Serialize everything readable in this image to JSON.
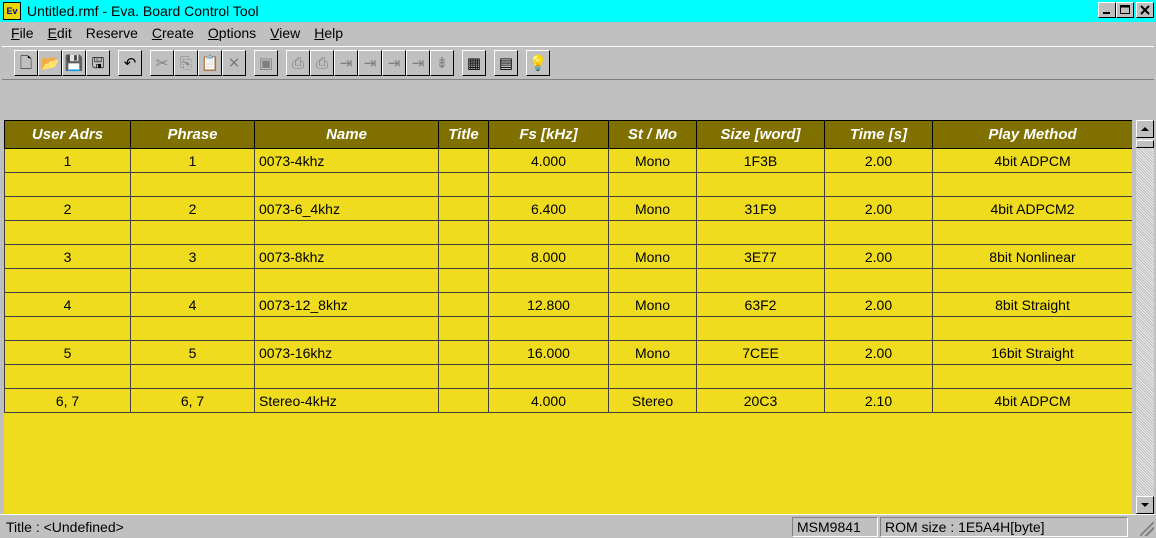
{
  "window": {
    "icon_text": "Ev",
    "title": "Untitled.rmf - Eva. Board Control Tool"
  },
  "menu": [
    {
      "label": "File",
      "underline": "F"
    },
    {
      "label": "Edit",
      "underline": "E"
    },
    {
      "label": "Reserve",
      "underline": ""
    },
    {
      "label": "Create",
      "underline": "C"
    },
    {
      "label": "Options",
      "underline": "O"
    },
    {
      "label": "View",
      "underline": "V"
    },
    {
      "label": "Help",
      "underline": "H"
    }
  ],
  "toolbar": {
    "buttons": [
      {
        "name": "new-document-icon",
        "glyph": "🗋",
        "enabled": true
      },
      {
        "name": "open-folder-icon",
        "glyph": "📂",
        "enabled": true
      },
      {
        "name": "save-icon",
        "glyph": "💾",
        "enabled": true
      },
      {
        "name": "save-as-icon",
        "glyph": "🖫",
        "enabled": true
      },
      {
        "name": "undo-icon",
        "glyph": "↶",
        "enabled": true
      },
      {
        "name": "cut-icon",
        "glyph": "✂",
        "enabled": false
      },
      {
        "name": "copy-icon",
        "glyph": "⎘",
        "enabled": false
      },
      {
        "name": "paste-icon",
        "glyph": "📋",
        "enabled": false
      },
      {
        "name": "delete-icon",
        "glyph": "✕",
        "enabled": false
      },
      {
        "name": "select-all-icon",
        "glyph": "▣",
        "enabled": false
      },
      {
        "name": "print-icon",
        "glyph": "⎙",
        "enabled": false
      },
      {
        "name": "print-setup-icon",
        "glyph": "⎙",
        "enabled": false
      },
      {
        "name": "insert-s-icon",
        "glyph": "⇥",
        "enabled": false
      },
      {
        "name": "insert-c-icon",
        "glyph": "⇥",
        "enabled": false
      },
      {
        "name": "insert-p-icon",
        "glyph": "⇥",
        "enabled": false
      },
      {
        "name": "insert-b-icon",
        "glyph": "⇥",
        "enabled": false
      },
      {
        "name": "insert-row-icon",
        "glyph": "⇟",
        "enabled": false
      },
      {
        "name": "chip-icon",
        "glyph": "▦",
        "enabled": true
      },
      {
        "name": "board-window-icon",
        "glyph": "▤",
        "enabled": true
      },
      {
        "name": "help-bulb-icon",
        "glyph": "💡",
        "enabled": true
      }
    ]
  },
  "table": {
    "columns": [
      "User Adrs",
      "Phrase",
      "Name",
      "Title",
      "Fs [kHz]",
      "St / Mo",
      "Size [word]",
      "Time [s]",
      "Play Method"
    ],
    "rows": [
      [
        "1",
        "1",
        "0073-4khz",
        "",
        "4.000",
        "Mono",
        "1F3B",
        "2.00",
        "4bit ADPCM"
      ],
      [
        "",
        "",
        "",
        "",
        "",
        "",
        "",
        "",
        ""
      ],
      [
        "2",
        "2",
        "0073-6_4khz",
        "",
        "6.400",
        "Mono",
        "31F9",
        "2.00",
        "4bit ADPCM2"
      ],
      [
        "",
        "",
        "",
        "",
        "",
        "",
        "",
        "",
        ""
      ],
      [
        "3",
        "3",
        "0073-8khz",
        "",
        "8.000",
        "Mono",
        "3E77",
        "2.00",
        "8bit Nonlinear"
      ],
      [
        "",
        "",
        "",
        "",
        "",
        "",
        "",
        "",
        ""
      ],
      [
        "4",
        "4",
        "0073-12_8khz",
        "",
        "12.800",
        "Mono",
        "63F2",
        "2.00",
        "8bit Straight"
      ],
      [
        "",
        "",
        "",
        "",
        "",
        "",
        "",
        "",
        ""
      ],
      [
        "5",
        "5",
        "0073-16khz",
        "",
        "16.000",
        "Mono",
        "7CEE",
        "2.00",
        "16bit Straight"
      ],
      [
        "",
        "",
        "",
        "",
        "",
        "",
        "",
        "",
        ""
      ],
      [
        "6, 7",
        "6, 7",
        "Stereo-4kHz",
        "",
        "4.000",
        "Stereo",
        "20C3",
        "2.10",
        "4bit ADPCM"
      ]
    ]
  },
  "status": {
    "title_text": "Title : <Undefined>",
    "device": "MSM9841",
    "rom_size": "ROM size : 1E5A4H[byte]"
  }
}
